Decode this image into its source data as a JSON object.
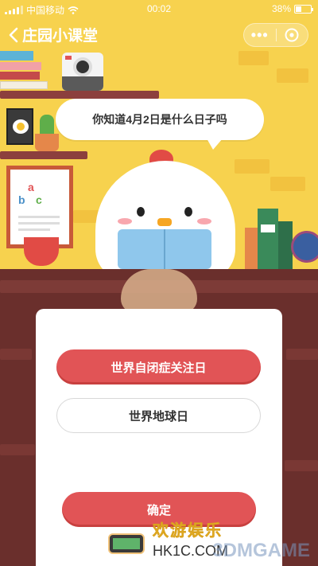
{
  "status_bar": {
    "carrier": "中国移动",
    "time": "00:02",
    "battery_percent": "38%",
    "battery_level": 0.38,
    "icons": [
      "signal-icon",
      "wifi-icon",
      "battery-icon"
    ]
  },
  "nav": {
    "title": "庄园小课堂",
    "more_label": "•••",
    "icons": [
      "back-icon",
      "more-icon",
      "close-icon"
    ]
  },
  "question": {
    "text": "你知道4月2日是什么日子吗"
  },
  "scene": {
    "poster_letters": [
      "a",
      "b",
      "c"
    ]
  },
  "options": [
    {
      "label": "世界自闭症关注日",
      "selected": true
    },
    {
      "label": "世界地球日",
      "selected": false
    }
  ],
  "confirm_label": "确定",
  "watermark": {
    "cn": "欢游娱乐",
    "en": "HK1C.COM",
    "gm": "3DMGAME"
  },
  "colors": {
    "wall": "#f7d24e",
    "accent": "#e15456",
    "counter": "#6a2f2c"
  }
}
